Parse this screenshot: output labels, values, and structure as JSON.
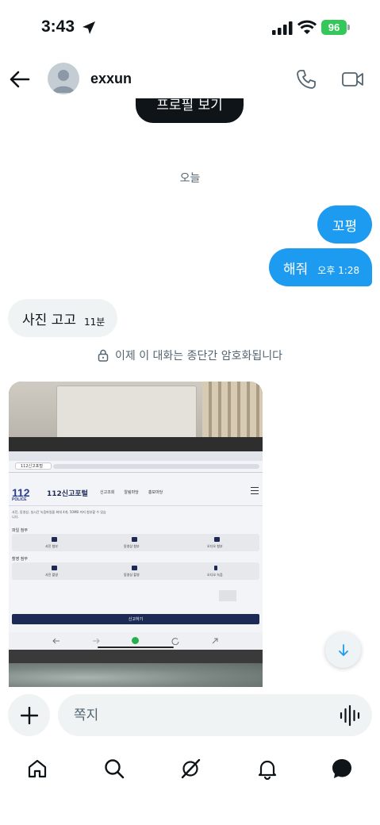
{
  "status_bar": {
    "time": "3:43",
    "battery": "96"
  },
  "header": {
    "username": "exxun"
  },
  "profile_button": {
    "label": "프로필 보기"
  },
  "date_separator": "오늘",
  "messages": [
    {
      "direction": "outgoing",
      "text": "꼬평",
      "time": ""
    },
    {
      "direction": "outgoing",
      "text": "해줘",
      "time": "오후 1:28"
    },
    {
      "direction": "incoming",
      "text": "사진 고고",
      "time": "11분"
    }
  ],
  "encryption_notice": "이제 이 대화는 종단간 암호화됩니다",
  "photo": {
    "tab_label": "112신고포털",
    "logo_text": "112",
    "logo_sub": "POLICE",
    "portal_title": "112신고포털",
    "nav": [
      "신고조회",
      "알림마당",
      "홍보마당"
    ],
    "note": "사진, 동영상, 실시간 녹음파일을 최대 4개, 50MB 까지 첨부할 수 있습니다.",
    "section_attach": "파일 첨부",
    "section_capture": "촬영 첨부",
    "attach_items": [
      "사진 첨부",
      "동영상 첨부",
      "오디오 첨부"
    ],
    "capture_items": [
      "사진 촬영",
      "동영상 촬영",
      "오디오 녹음"
    ],
    "submit_label": "신고하기"
  },
  "composer": {
    "placeholder": "쪽지"
  },
  "colors": {
    "accent": "#1d9bf0",
    "battery": "#34c759",
    "bubble_in": "#eff3f4"
  },
  "tabs": [
    "home-icon",
    "search-icon",
    "grok-icon",
    "notifications-icon",
    "messages-icon"
  ]
}
